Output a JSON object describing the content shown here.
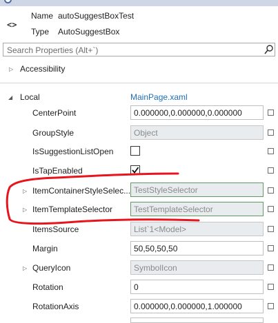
{
  "header": {
    "name_label": "Name",
    "name_value": "autoSuggestBoxTest",
    "type_label": "Type",
    "type_value": "AutoSuggestBox",
    "icon": "code-icon"
  },
  "search": {
    "placeholder": "Search Properties (Alt+`)"
  },
  "sections": {
    "accessibility": "Accessibility",
    "local": "Local",
    "local_link": "MainPage.xaml"
  },
  "properties": [
    {
      "name": "CenterPoint",
      "value": "0.000000,0.000000,0.000000",
      "kind": "text"
    },
    {
      "name": "GroupStyle",
      "value": "Object",
      "kind": "readonly"
    },
    {
      "name": "IsSuggestionListOpen",
      "value": "",
      "kind": "checkbox",
      "checked": false
    },
    {
      "name": "IsTapEnabled",
      "value": "",
      "kind": "checkbox",
      "checked": true
    },
    {
      "name": "ItemContainerStyleSelec...",
      "value": "TestStyleSelector",
      "kind": "resource",
      "expandable": true
    },
    {
      "name": "ItemTemplateSelector",
      "value": "TestTemplateSelector",
      "kind": "resource",
      "expandable": true
    },
    {
      "name": "ItemsSource",
      "value": "List`1<Model>",
      "kind": "readonly"
    },
    {
      "name": "Margin",
      "value": "50,50,50,50",
      "kind": "text"
    },
    {
      "name": "QueryIcon",
      "value": "SymbolIcon",
      "kind": "readonly",
      "expandable": true
    },
    {
      "name": "Rotation",
      "value": "0",
      "kind": "text"
    },
    {
      "name": "RotationAxis",
      "value": "0.000000,0.000000,1.000000",
      "kind": "text"
    }
  ],
  "annotation_color": "#e8141c"
}
